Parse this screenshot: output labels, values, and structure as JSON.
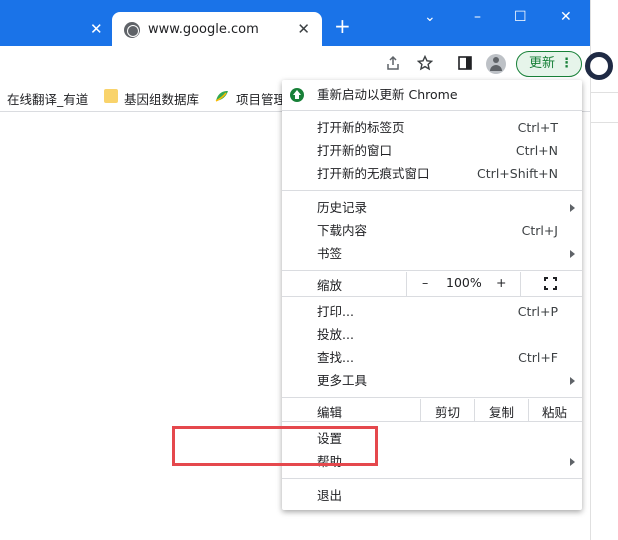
{
  "window": {
    "active_tab_title": "www.google.com",
    "controls": {
      "collapse": "⌄",
      "minimize": "–",
      "maximize": "☐",
      "close": "✕"
    }
  },
  "tabs": {
    "close_glyph": "✕",
    "new_tab_glyph": "+"
  },
  "toolbar": {
    "update_button_label": "更新",
    "menu_glyph": "⋮"
  },
  "bookmarks": [
    {
      "label": "在线翻译_有道"
    },
    {
      "label": "基因组数据库"
    },
    {
      "label": "项目管理"
    }
  ],
  "menu": {
    "restart_update": "重新启动以更新 Chrome",
    "group1": [
      {
        "label": "打开新的标签页",
        "shortcut": "Ctrl+T"
      },
      {
        "label": "打开新的窗口",
        "shortcut": "Ctrl+N"
      },
      {
        "label": "打开新的无痕式窗口",
        "shortcut": "Ctrl+Shift+N"
      }
    ],
    "group2": [
      {
        "label": "历史记录",
        "shortcut": ""
      },
      {
        "label": "下载内容",
        "shortcut": "Ctrl+J"
      },
      {
        "label": "书签",
        "shortcut": ""
      }
    ],
    "zoom": {
      "label": "缩放",
      "minus": "–",
      "value": "100%",
      "plus": "+"
    },
    "group3": [
      {
        "label": "打印...",
        "shortcut": "Ctrl+P"
      },
      {
        "label": "投放...",
        "shortcut": ""
      },
      {
        "label": "查找...",
        "shortcut": "Ctrl+F"
      },
      {
        "label": "更多工具",
        "shortcut": ""
      }
    ],
    "edit": {
      "label": "编辑",
      "cut": "剪切",
      "copy": "复制",
      "paste": "粘贴"
    },
    "settings": "设置",
    "help": "帮助",
    "exit": "退出"
  },
  "colors": {
    "tabstrip": "#1a73e8",
    "update_green": "#188038",
    "highlight_red": "#e5484d"
  }
}
